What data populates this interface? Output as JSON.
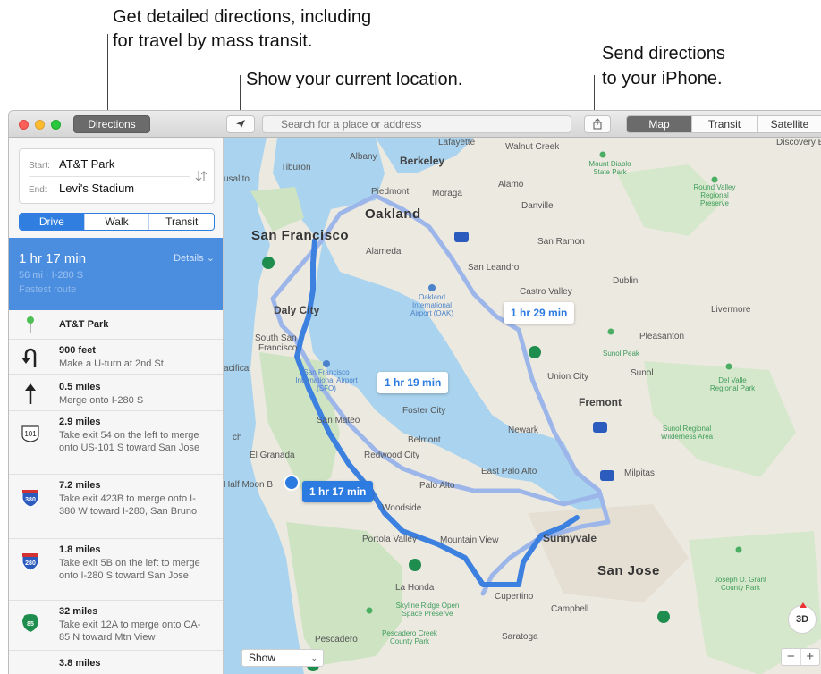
{
  "callouts": {
    "directions_line1": "Get detailed directions, including",
    "directions_line2": "for travel by mass transit.",
    "location": "Show your current location.",
    "send_line1": "Send directions",
    "send_line2": "to your iPhone."
  },
  "toolbar": {
    "directions_label": "Directions",
    "search_placeholder": "Search for a place or address",
    "location_icon": "location-arrow-icon",
    "share_icon": "share-icon",
    "map_types": [
      "Map",
      "Transit",
      "Satellite"
    ],
    "selected_map_type": "Map"
  },
  "sidebar": {
    "start_label": "Start:",
    "start_value": "AT&T Park",
    "end_label": "End:",
    "end_value": "Levi's Stadium",
    "modes": [
      "Drive",
      "Walk",
      "Transit"
    ],
    "selected_mode": "Drive",
    "route": {
      "time": "1 hr 17 min",
      "meta": "56 mi · I-280 S",
      "note": "Fastest route",
      "details_label": "Details ⌄"
    },
    "steps": [
      {
        "icon": "pin-icon",
        "distance": "AT&T Park",
        "desc": ""
      },
      {
        "icon": "u-turn-icon",
        "distance": "900 feet",
        "desc": "Make a U-turn at 2nd St"
      },
      {
        "icon": "straight-arrow-icon",
        "distance": "0.5 miles",
        "desc": "Merge onto I-280 S"
      },
      {
        "icon": "us-101-shield-icon",
        "shield": "101",
        "distance": "2.9 miles",
        "desc": "Take exit 54 on the left to merge onto US-101 S toward San Jose"
      },
      {
        "icon": "interstate-380-shield-icon",
        "shield": "380",
        "distance": "7.2 miles",
        "desc": "Take exit 423B to merge onto I-380 W toward I-280, San Bruno"
      },
      {
        "icon": "interstate-280-shield-icon",
        "shield": "280",
        "distance": "1.8 miles",
        "desc": "Take exit 5B on the left to merge onto I-280 S toward San Jose"
      },
      {
        "icon": "state-route-85-shield-icon",
        "shield": "85",
        "distance": "32 miles",
        "desc": "Take exit 12A to merge onto CA-85 N toward Mtn View"
      },
      {
        "icon": "",
        "distance": "3.8 miles",
        "desc": ""
      }
    ]
  },
  "map": {
    "cities": {
      "san_francisco": "San Francisco",
      "oakland": "Oakland",
      "berkeley": "Berkeley",
      "daly_city": "Daly City",
      "fremont": "Fremont",
      "sunnyvale": "Sunnyvale",
      "san_jose": "San Jose"
    },
    "places": {
      "lafayette": "Lafayette",
      "walnut_creek": "Walnut Creek",
      "albany": "Albany",
      "tiburon": "Tiburon",
      "piedmont": "Piedmont",
      "moraga": "Moraga",
      "alamo": "Alamo",
      "danville": "Danville",
      "alameda": "Alameda",
      "san_ramon": "San Ramon",
      "san_leandro": "San Leandro",
      "castro_valley": "Castro Valley",
      "dublin": "Dublin",
      "livermore": "Livermore",
      "pleasanton": "Pleasanton",
      "south_sf_1": "South San",
      "south_sf_2": "Francisco",
      "union_city": "Union City",
      "sunol": "Sunol",
      "san_mateo": "San Mateo",
      "foster_city": "Foster City",
      "belmont": "Belmont",
      "newark": "Newark",
      "el_granada": "El Granada",
      "redwood_city": "Redwood City",
      "east_palo_alto": "East Palo Alto",
      "half_moon": "Half Moon B",
      "palo_alto": "Palo Alto",
      "woodside": "Woodside",
      "milpitas": "Milpitas",
      "portola_valley": "Portola Valley",
      "mountain_view": "Mountain View",
      "la_honda": "La Honda",
      "cupertino": "Cupertino",
      "campbell": "Campbell",
      "saratoga": "Saratoga",
      "pescadero": "Pescadero",
      "usalito": "usalito",
      "acifica": "acifica",
      "ch": "ch",
      "discovery_bay": "Discovery Bay"
    },
    "parks": {
      "mount_diablo": "Mount Diablo State Park",
      "round_valley": "Round Valley Regional Preserve",
      "sunol_peak": "Sunol Peak",
      "del_valle": "Del Valle Regional Park",
      "sunol_regional": "Sunol Regional Wilderness Area",
      "skyline_ridge": "Skyline Ridge Open Space Preserve",
      "pescadero_creek": "Pescadero Creek County Park",
      "joseph_grant": "Joseph D. Grant County Park"
    },
    "airports": {
      "oakland": "Oakland International Airport (OAK)",
      "sfo": "San Francisco International Airport (SFO)"
    },
    "route_times": {
      "primary": "1 hr 17 min",
      "alt1": "1 hr 19 min",
      "alt2": "1 hr 29 min"
    },
    "show_label": "Show",
    "btn_3d": "3D",
    "zoom_out": "−",
    "zoom_in": "+"
  }
}
